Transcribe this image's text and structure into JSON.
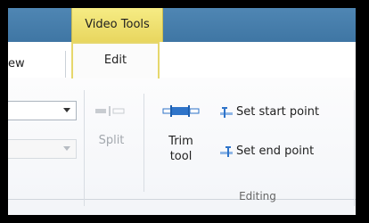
{
  "context_tab": {
    "header": "Video Tools"
  },
  "tabs": [
    {
      "label": "ew"
    },
    {
      "label": "Edit"
    }
  ],
  "editing": {
    "split_label": "Split",
    "trim_label_line1": "Trim",
    "trim_label_line2": "tool",
    "set_start_label": "Set start point",
    "set_end_label": "Set end point",
    "group_label": "Editing"
  },
  "colors": {
    "context_yellow": "#f6ec85",
    "titlebar_blue": "#4f86b3",
    "trim_icon_blue": "#2f74c9",
    "disabled_gray": "#a3a8ae"
  },
  "icons": {
    "split": "split-icon",
    "trim": "trim-tool-icon",
    "start": "set-start-point-icon",
    "end": "set-end-point-icon",
    "dropdown": "chevron-down-icon"
  }
}
